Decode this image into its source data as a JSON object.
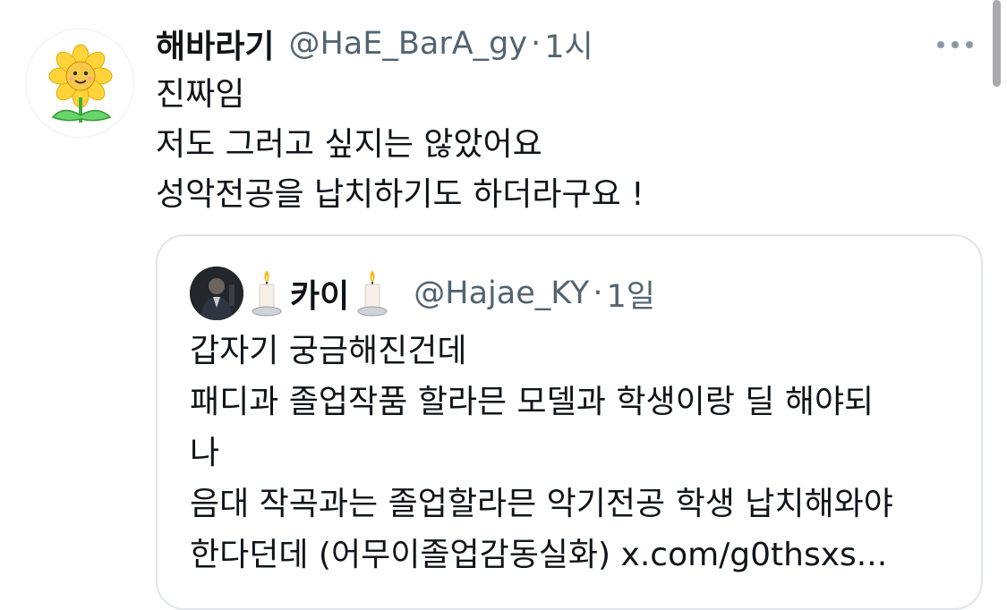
{
  "tweet": {
    "author": {
      "display_name": "해바라기",
      "handle": "@HaE_BarA_gy",
      "time": "1시",
      "avatar_icon": "sunflower-avatar"
    },
    "separator": "·",
    "more_icon": "more-dots-icon",
    "text_lines": [
      "진짜임",
      "저도 그러고 싶지는 않았어요",
      "성악전공을 납치하기도 하더라구요 !"
    ]
  },
  "quote": {
    "author": {
      "display_name": "카이",
      "handle": "@Hajae_KY",
      "time": "1일",
      "avatar_icon": "person-avatar",
      "name_decoration_icon": "candle-icon"
    },
    "separator": "·",
    "text_lines": [
      "갑자기 궁금해진건데",
      "패디과 졸업작품 할라믄 모델과 학생이랑 딜 해야되",
      "나",
      "음대 작곡과는 졸업할라믄 악기전공 학생 납치해와야",
      "한다던데 (어무이졸업감동실화) x.com/g0thsxs..."
    ]
  },
  "colors": {
    "text_primary": "#0f1419",
    "text_secondary": "#536471",
    "card_border": "#dfe4e8"
  }
}
